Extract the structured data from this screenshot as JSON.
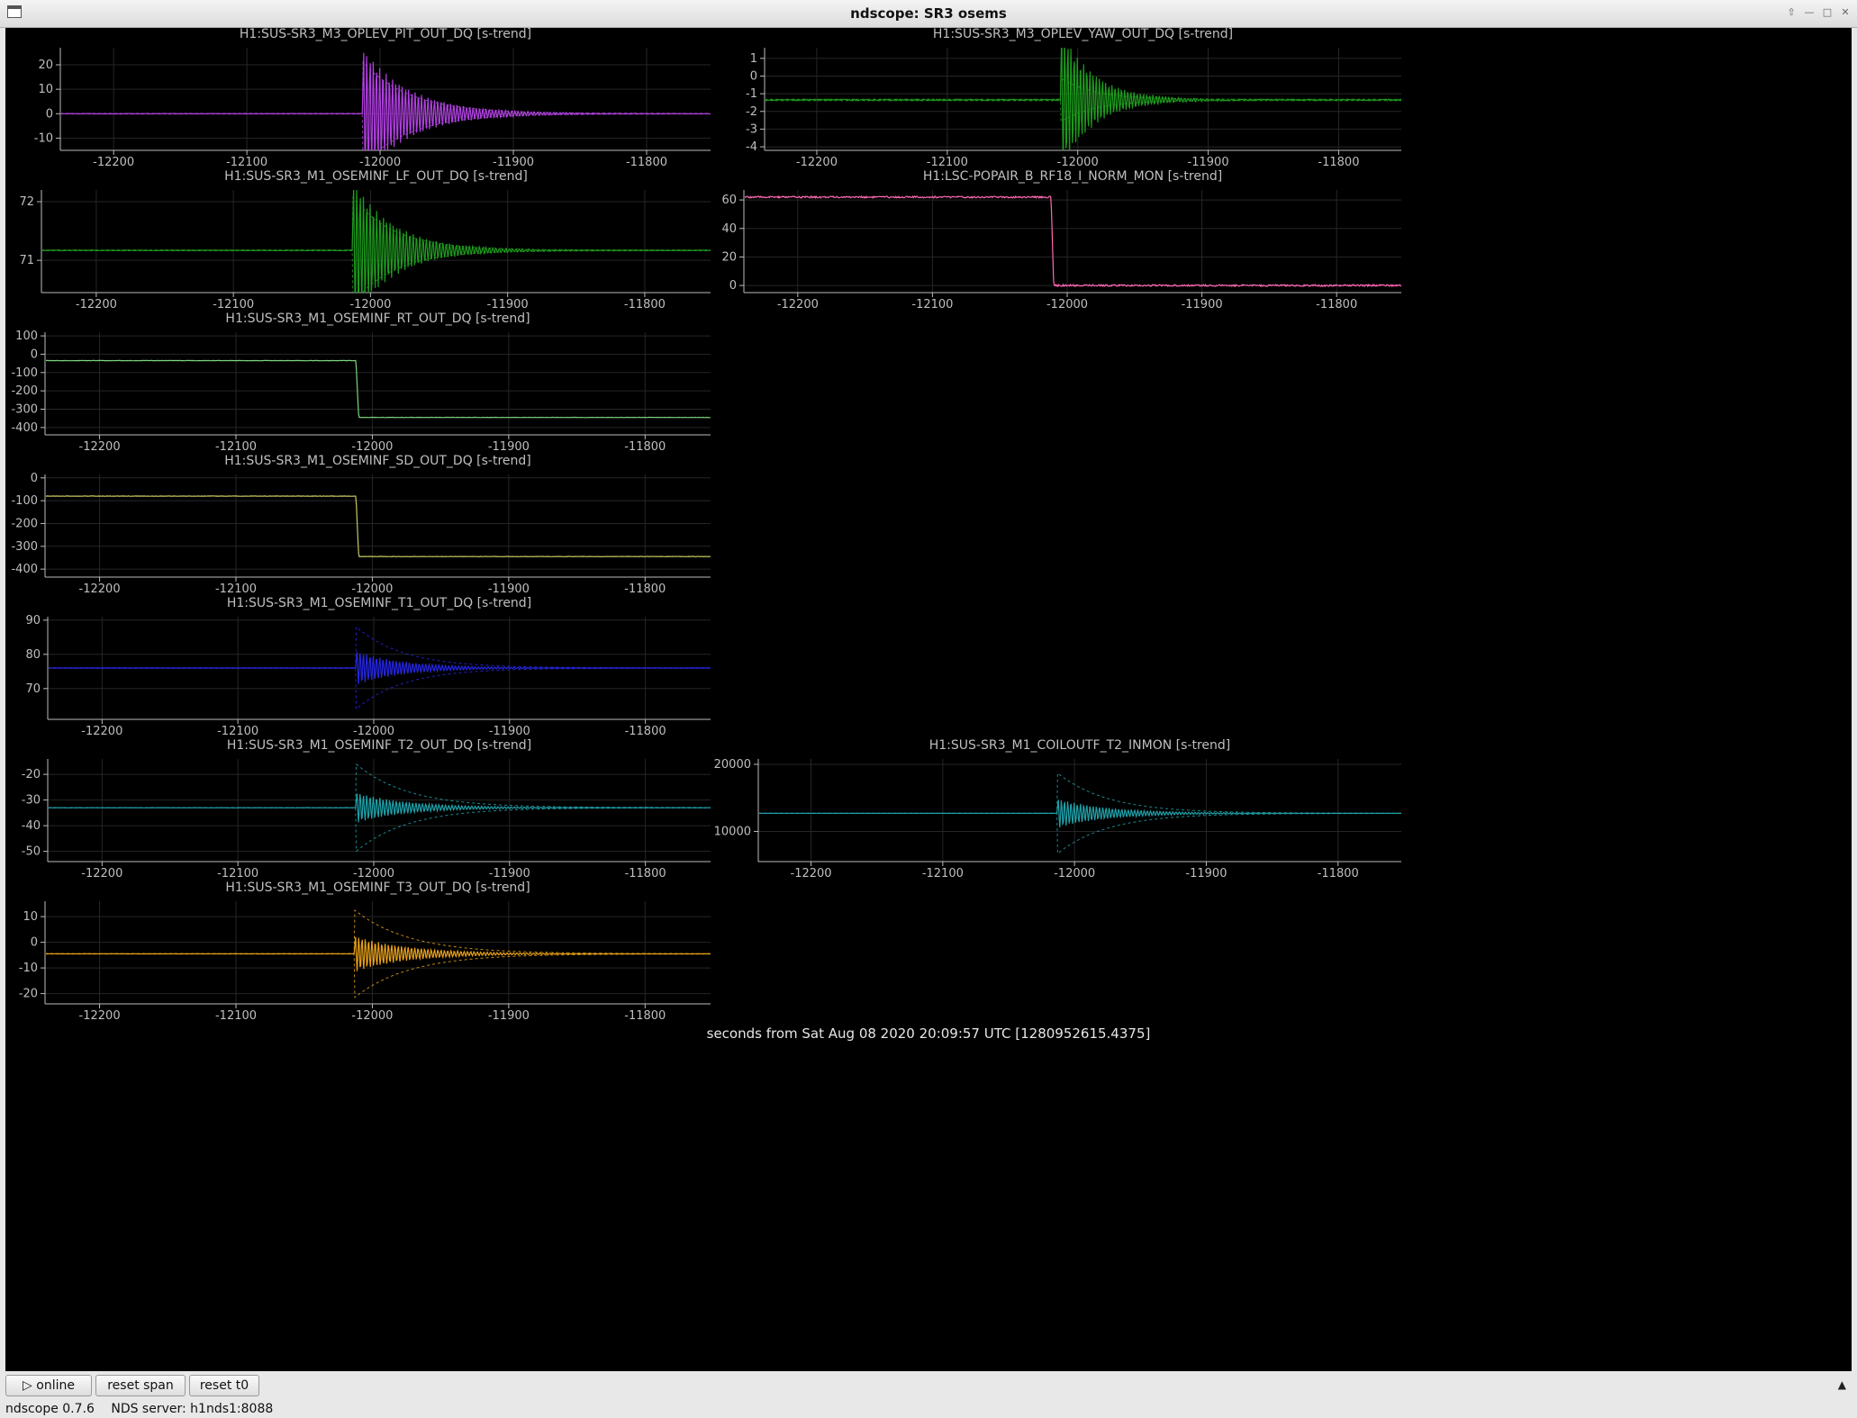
{
  "window": {
    "title": "ndscope: SR3 osems"
  },
  "xaxis_label": "seconds from Sat Aug 08 2020 20:09:57 UTC [1280952615.4375]",
  "controls": {
    "online": "online",
    "online_icon": "▷",
    "reset_span": "reset span",
    "reset_t0": "reset t0",
    "collapse_icon": "▲"
  },
  "status": {
    "version": "ndscope 0.7.6",
    "server": "NDS server: h1nds1:8088"
  },
  "colors": {
    "background": "#000000",
    "grid": "#262626",
    "axis": "#bbbbbb",
    "text": "#bfbfbf"
  },
  "chart_data": [
    {
      "type": "line",
      "title": "H1:SUS-SR3_M3_OPLEV_PIT_OUT_DQ [s-trend]",
      "color": "#b040e0",
      "xlim": [
        -12240,
        -11752
      ],
      "x_ticks": [
        -12200,
        -12100,
        -12000,
        -11900,
        -11800
      ],
      "ylim": [
        -15,
        27
      ],
      "y_ticks": [
        -10,
        0,
        10,
        20
      ],
      "series": [
        {
          "pre_mean": 0,
          "post_mean": 0,
          "step_x": -12011,
          "burst_start": -12013,
          "burst_amp": 27,
          "envelope_amp": 21,
          "decay": 35,
          "ripple": 0.1
        }
      ]
    },
    {
      "type": "line",
      "title": "H1:SUS-SR3_M3_OPLEV_YAW_OUT_DQ [s-trend]",
      "color": "#1e9a1e",
      "xlim": [
        -12240,
        -11752
      ],
      "x_ticks": [
        -12200,
        -12100,
        -12000,
        -11900,
        -11800
      ],
      "ylim": [
        -4.2,
        1.6
      ],
      "y_ticks": [
        -4,
        -3,
        -2,
        -1,
        0,
        1
      ],
      "series": [
        {
          "pre_mean": -1.35,
          "post_mean": -1.35,
          "step_x": -12011,
          "burst_start": -12013,
          "burst_amp": 4,
          "envelope_amp": 1.2,
          "decay": 25,
          "ripple": 0.04
        }
      ]
    },
    {
      "type": "line",
      "title": "H1:SUS-SR3_M1_OSEMINF_LF_OUT_DQ [s-trend]",
      "color": "#1e9a1e",
      "xlim": [
        -12240,
        -11752
      ],
      "x_ticks": [
        -12200,
        -12100,
        -12000,
        -11900,
        -11800
      ],
      "ylim": [
        70.45,
        72.2
      ],
      "y_ticks": [
        71,
        72
      ],
      "series": [
        {
          "pre_mean": 71.17,
          "post_mean": 71.17,
          "step_x": -12011,
          "burst_start": -12013,
          "burst_amp": 1.2,
          "envelope_amp": 0.9,
          "decay": 30,
          "ripple": 0.006
        }
      ]
    },
    {
      "type": "line",
      "title": "H1:LSC-POPAIR_B_RF18_I_NORM_MON [s-trend]",
      "color": "#ff69b4",
      "xlim": [
        -12240,
        -11752
      ],
      "x_ticks": [
        -12200,
        -12100,
        -12000,
        -11900,
        -11800
      ],
      "ylim": [
        -5,
        67
      ],
      "y_ticks": [
        0,
        20,
        40,
        60
      ],
      "series": [
        {
          "pre_mean": 62,
          "post_mean": 0,
          "step_x": -12012,
          "burst_start": -12012,
          "burst_amp": 0,
          "envelope_amp": 0,
          "decay": 10,
          "ripple": 0.6
        }
      ]
    },
    {
      "type": "line",
      "title": "H1:SUS-SR3_M1_OSEMINF_RT_OUT_DQ [s-trend]",
      "color": "#7ed47e",
      "xlim": [
        -12240,
        -11752
      ],
      "x_ticks": [
        -12200,
        -12100,
        -12000,
        -11900,
        -11800
      ],
      "ylim": [
        -440,
        120
      ],
      "y_ticks": [
        -400,
        -300,
        -200,
        -100,
        0,
        100
      ],
      "series": [
        {
          "pre_mean": -35,
          "post_mean": -345,
          "step_x": -12012,
          "burst_start": -12012,
          "burst_amp": 0,
          "envelope_amp": 0,
          "decay": 10,
          "ripple": 1
        }
      ]
    },
    {
      "type": "line",
      "title": "H1:SUS-SR3_M1_OSEMINF_SD_OUT_DQ [s-trend]",
      "color": "#c8c864",
      "xlim": [
        -12240,
        -11752
      ],
      "x_ticks": [
        -12200,
        -12100,
        -12000,
        -11900,
        -11800
      ],
      "ylim": [
        -435,
        15
      ],
      "y_ticks": [
        -400,
        -300,
        -200,
        -100,
        0
      ],
      "series": [
        {
          "pre_mean": -80,
          "post_mean": -345,
          "step_x": -12012,
          "burst_start": -12012,
          "burst_amp": 0,
          "envelope_amp": 0,
          "decay": 10,
          "ripple": 1
        }
      ]
    },
    {
      "type": "line",
      "title": "H1:SUS-SR3_M1_OSEMINF_T1_OUT_DQ [s-trend]",
      "color": "#2626e0",
      "xlim": [
        -12240,
        -11752
      ],
      "x_ticks": [
        -12200,
        -12100,
        -12000,
        -11900,
        -11800
      ],
      "ylim": [
        61,
        91
      ],
      "y_ticks": [
        70,
        80,
        90
      ],
      "series": [
        {
          "pre_mean": 76,
          "post_mean": 76,
          "step_x": -12011,
          "burst_start": -12013,
          "burst_amp": 5,
          "envelope_amp": 12,
          "decay": 35,
          "ripple": 0.05
        }
      ]
    },
    {
      "type": "line",
      "title": "H1:SUS-SR3_M1_OSEMINF_T2_OUT_DQ [s-trend]",
      "color": "#20a0a8",
      "xlim": [
        -12240,
        -11752
      ],
      "x_ticks": [
        -12200,
        -12100,
        -12000,
        -11900,
        -11800
      ],
      "ylim": [
        -54,
        -14
      ],
      "y_ticks": [
        -50,
        -40,
        -30,
        -20
      ],
      "series": [
        {
          "pre_mean": -33,
          "post_mean": -33,
          "step_x": -12011,
          "burst_start": -12013,
          "burst_amp": 6,
          "envelope_amp": 17,
          "decay": 38,
          "ripple": 0.05
        }
      ]
    },
    {
      "type": "line",
      "title": "H1:SUS-SR3_M1_COILOUTF_T2_INMON [s-trend]",
      "color": "#20a0a8",
      "xlim": [
        -12240,
        -11752
      ],
      "x_ticks": [
        -12200,
        -12100,
        -12000,
        -11900,
        -11800
      ],
      "ylim": [
        5500,
        20800
      ],
      "y_ticks": [
        10000,
        20000
      ],
      "series": [
        {
          "pre_mean": 12700,
          "post_mean": 12700,
          "step_x": -12011,
          "burst_start": -12013,
          "burst_amp": 2200,
          "envelope_amp": 6000,
          "decay": 38,
          "ripple": 15
        }
      ]
    },
    {
      "type": "line",
      "title": "H1:SUS-SR3_M1_OSEMINF_T3_OUT_DQ [s-trend]",
      "color": "#e8a018",
      "xlim": [
        -12240,
        -11752
      ],
      "x_ticks": [
        -12200,
        -12100,
        -12000,
        -11900,
        -11800
      ],
      "ylim": [
        -24,
        16
      ],
      "y_ticks": [
        -20,
        -10,
        0,
        10
      ],
      "series": [
        {
          "pre_mean": -4.5,
          "post_mean": -4.5,
          "step_x": -12011,
          "burst_start": -12013,
          "burst_amp": 7,
          "envelope_amp": 17,
          "decay": 40,
          "ripple": 0.05
        }
      ]
    }
  ]
}
